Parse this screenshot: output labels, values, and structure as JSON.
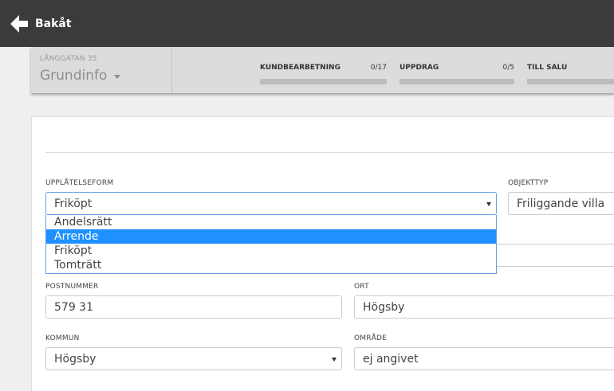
{
  "topbar": {
    "back_label": "Bakåt"
  },
  "subbar": {
    "address": "LÅNGGATAN 35",
    "section": "Grundinfo",
    "progress": [
      {
        "label": "KUNDBEARBETNING",
        "count": "0/17",
        "value": 0
      },
      {
        "label": "UPPDRAG",
        "count": "0/5",
        "value": 0
      },
      {
        "label": "TILL SALU",
        "count": "",
        "value": 0
      }
    ]
  },
  "form": {
    "upplatelseform": {
      "label": "UPPLÅTELSEFORM",
      "value": "Friköpt",
      "options": [
        "Andelsrätt",
        "Arrende",
        "Friköpt",
        "Tomträtt"
      ],
      "highlighted": "Arrende"
    },
    "objekttyp": {
      "label": "OBJEKTTYP",
      "value": "Friliggande villa"
    },
    "postnummer": {
      "label": "POSTNUMMER",
      "value": "579 31"
    },
    "ort": {
      "label": "ORT",
      "value": "Högsby"
    },
    "kommun": {
      "label": "KOMMUN",
      "value": "Högsby"
    },
    "omrade": {
      "label": "OMRÅDE",
      "value": "ej angivet"
    }
  },
  "colors": {
    "topbar": "#3c3a3a",
    "highlight": "#1e90ff",
    "focus_border": "#66a3e0"
  }
}
